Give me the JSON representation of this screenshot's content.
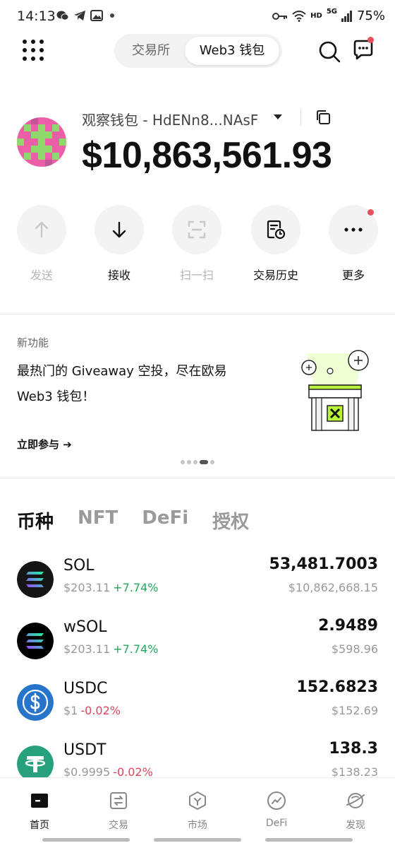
{
  "status_bar": {
    "time": "14:13",
    "network": "HD",
    "signal": "5G",
    "battery": "75%"
  },
  "top_nav": {
    "tabs": [
      {
        "label": "交易所",
        "active": false
      },
      {
        "label": "Web3 钱包",
        "active": true
      }
    ]
  },
  "wallet": {
    "name": "观察钱包 - HdENn8...NAsF",
    "balance": "$10,863,561.93"
  },
  "actions": [
    {
      "label": "发送",
      "icon": "arrow-up-icon",
      "enabled": false
    },
    {
      "label": "接收",
      "icon": "arrow-down-icon",
      "enabled": true
    },
    {
      "label": "扫一扫",
      "icon": "scan-icon",
      "enabled": false
    },
    {
      "label": "交易历史",
      "icon": "history-icon",
      "enabled": true
    },
    {
      "label": "更多",
      "icon": "more-icon",
      "enabled": true
    }
  ],
  "banner": {
    "tag": "新功能",
    "line1": "最热门的 Giveaway 空投，尽在欧易",
    "line2": "Web3 钱包！",
    "cta": "立即参与 ➔",
    "page_index": 4,
    "page_count": 5
  },
  "asset_tabs": [
    {
      "label": "币种",
      "active": true
    },
    {
      "label": "NFT",
      "active": false
    },
    {
      "label": "DeFi",
      "active": false
    },
    {
      "label": "授权",
      "active": false
    }
  ],
  "tokens": [
    {
      "symbol": "SOL",
      "price": "$203.11",
      "change": "+7.74%",
      "amount": "53,481.7003",
      "value": "$10,862,668.15",
      "icon": "sol-icon"
    },
    {
      "symbol": "wSOL",
      "price": "$203.11",
      "change": "+7.74%",
      "amount": "2.9489",
      "value": "$598.96",
      "icon": "wsol-icon"
    },
    {
      "symbol": "USDC",
      "price": "$1",
      "change": "-0.02%",
      "amount": "152.6823",
      "value": "$152.69",
      "icon": "usdc-icon"
    },
    {
      "symbol": "USDT",
      "price": "$0.9995",
      "change": "-0.02%",
      "amount": "138.3",
      "value": "$138.23",
      "icon": "usdt-icon"
    }
  ],
  "bottom_nav": [
    {
      "label": "首页",
      "icon": "wallet-icon",
      "active": true
    },
    {
      "label": "交易",
      "icon": "swap-icon",
      "active": false
    },
    {
      "label": "市场",
      "icon": "market-icon",
      "active": false
    },
    {
      "label": "DeFi",
      "icon": "defi-icon",
      "active": false
    },
    {
      "label": "发现",
      "icon": "discover-icon",
      "active": false
    }
  ],
  "colors": {
    "positive": "#22a85a",
    "negative": "#e0445a",
    "notification": "#e8505b",
    "accent_green": "#b8f23a"
  }
}
